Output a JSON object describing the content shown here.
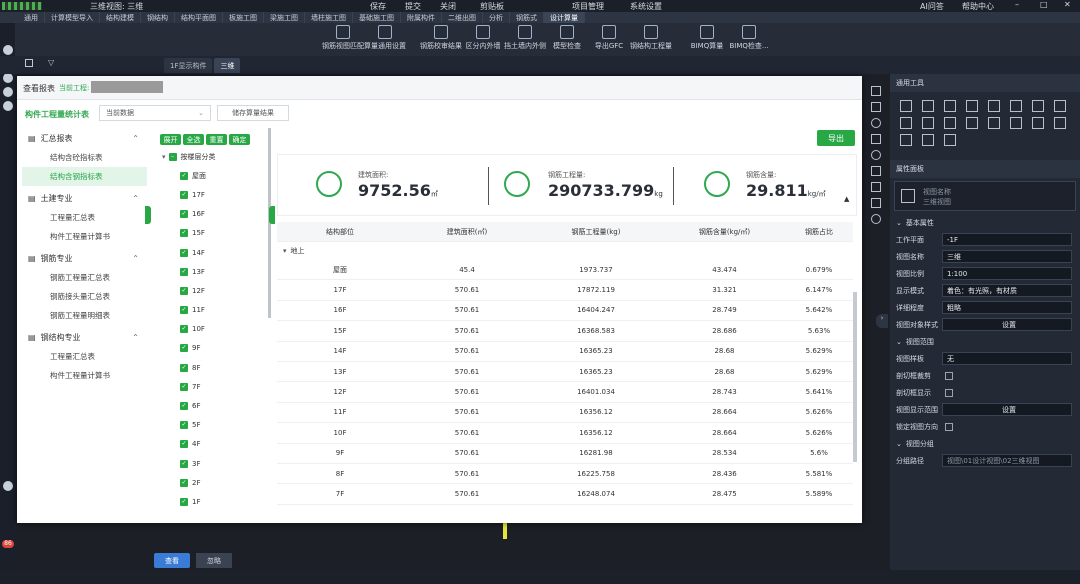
{
  "app": {
    "window_title": "三维视图: 三维",
    "save": "保存",
    "submit": "提交",
    "close": "关闭",
    "clipboard": "剪贴板",
    "project_manage": "项目管理",
    "system_settings": "系统设置",
    "ai_qa": "AI问答",
    "help_center": "帮助中心"
  },
  "ribbon_tabs": [
    "通用",
    "计算模型导入",
    "结构建模",
    "钢结构",
    "结构平面图",
    "板施工图",
    "梁施工图",
    "墙柱施工图",
    "基础施工图",
    "附属构件",
    "二维出图",
    "分析",
    "钢筋式",
    "设计算量"
  ],
  "active_tab_index": 13,
  "ribbon_buttons": [
    "钢筋视图匹配",
    "算量通用设置",
    "钢筋校审结果",
    "区分内外墙",
    "挡土墙内外侧",
    "模型检查",
    "导出GFC",
    "钢结构工程量",
    "BIMQ算量",
    "BIMQ检查..."
  ],
  "view_tabs": [
    "1F显示构件",
    "三维"
  ],
  "dialog": {
    "title": "查看报表",
    "current_project_label": "当前工程:",
    "report_name": "构件工程量统计表",
    "data_select": "当前数据",
    "save_result": "储存算量结果",
    "export": "导出",
    "nav": [
      {
        "header": "汇总报表",
        "items": [
          "结构含砼指标表",
          "结构含钢指标表"
        ]
      },
      {
        "header": "土建专业",
        "items": [
          "工程量汇总表",
          "构件工程量计算书"
        ]
      },
      {
        "header": "钢筋专业",
        "items": [
          "钢筋工程量汇总表",
          "钢筋接头量汇总表",
          "钢筋工程量明细表"
        ]
      },
      {
        "header": "钢结构专业",
        "items": [
          "工程量汇总表",
          "构件工程量计算书"
        ]
      }
    ],
    "selected_nav": "结构含钢指标表",
    "tree_buttons": [
      "展开",
      "全选",
      "重置",
      "确定"
    ],
    "tree_root": "按楼层分类",
    "tree_items": [
      "屋面",
      "17F",
      "16F",
      "15F",
      "14F",
      "13F",
      "12F",
      "11F",
      "10F",
      "9F",
      "8F",
      "7F",
      "6F",
      "5F",
      "4F",
      "3F",
      "2F",
      "1F"
    ],
    "stats": [
      {
        "label": "建筑面积:",
        "value": "9752.56",
        "unit": "㎡"
      },
      {
        "label": "钢筋工程量:",
        "value": "290733.799",
        "unit": "kg"
      },
      {
        "label": "钢筋含量:",
        "value": "29.811",
        "unit": "kg/㎡"
      }
    ],
    "table": {
      "headers": [
        "结构部位",
        "建筑面积(㎡)",
        "钢筋工程量(kg)",
        "钢筋含量(kg/㎡)",
        "钢筋占比"
      ],
      "group": "地上",
      "rows": [
        [
          "屋面",
          "45.4",
          "1973.737",
          "43.474",
          "0.679%"
        ],
        [
          "17F",
          "570.61",
          "17872.119",
          "31.321",
          "6.147%"
        ],
        [
          "16F",
          "570.61",
          "16404.247",
          "28.749",
          "5.642%"
        ],
        [
          "15F",
          "570.61",
          "16368.583",
          "28.686",
          "5.63%"
        ],
        [
          "14F",
          "570.61",
          "16365.23",
          "28.68",
          "5.629%"
        ],
        [
          "13F",
          "570.61",
          "16365.23",
          "28.68",
          "5.629%"
        ],
        [
          "12F",
          "570.61",
          "16401.034",
          "28.743",
          "5.641%"
        ],
        [
          "11F",
          "570.61",
          "16356.12",
          "28.664",
          "5.626%"
        ],
        [
          "10F",
          "570.61",
          "16356.12",
          "28.664",
          "5.626%"
        ],
        [
          "9F",
          "570.61",
          "16281.98",
          "28.534",
          "5.6%"
        ],
        [
          "8F",
          "570.61",
          "16225.758",
          "28.436",
          "5.581%"
        ],
        [
          "7F",
          "570.61",
          "16248.074",
          "28.475",
          "5.589%"
        ]
      ]
    },
    "view_btn": "查看",
    "ignore_btn": "忽略"
  },
  "props": {
    "general_tools": "通用工具",
    "panel_title": "属性面板",
    "view_name_hint": "视图名称",
    "view_type_hint": "三维视图",
    "basic": "基本属性",
    "rows": [
      {
        "label": "工作平面",
        "value": "-1F"
      },
      {
        "label": "视图名称",
        "value": "三维"
      },
      {
        "label": "视图比例",
        "value": "1:100"
      },
      {
        "label": "显示模式",
        "value": "着色：有光照，有材质"
      },
      {
        "label": "详细程度",
        "value": "粗略"
      },
      {
        "label": "视图对象样式",
        "value": "设置"
      }
    ],
    "range": "视图范围",
    "range_rows": [
      {
        "label": "视图样板",
        "value": "无"
      },
      {
        "label": "剖切框裁剪",
        "value": ""
      },
      {
        "label": "剖切框显示",
        "value": ""
      },
      {
        "label": "视图显示范围",
        "value": "设置"
      },
      {
        "label": "锁定视图方向",
        "value": ""
      }
    ],
    "group": "视图分组",
    "group_path_label": "分组路径",
    "group_path": "视图\\01设计视图\\02三维视图"
  },
  "badge": "86"
}
